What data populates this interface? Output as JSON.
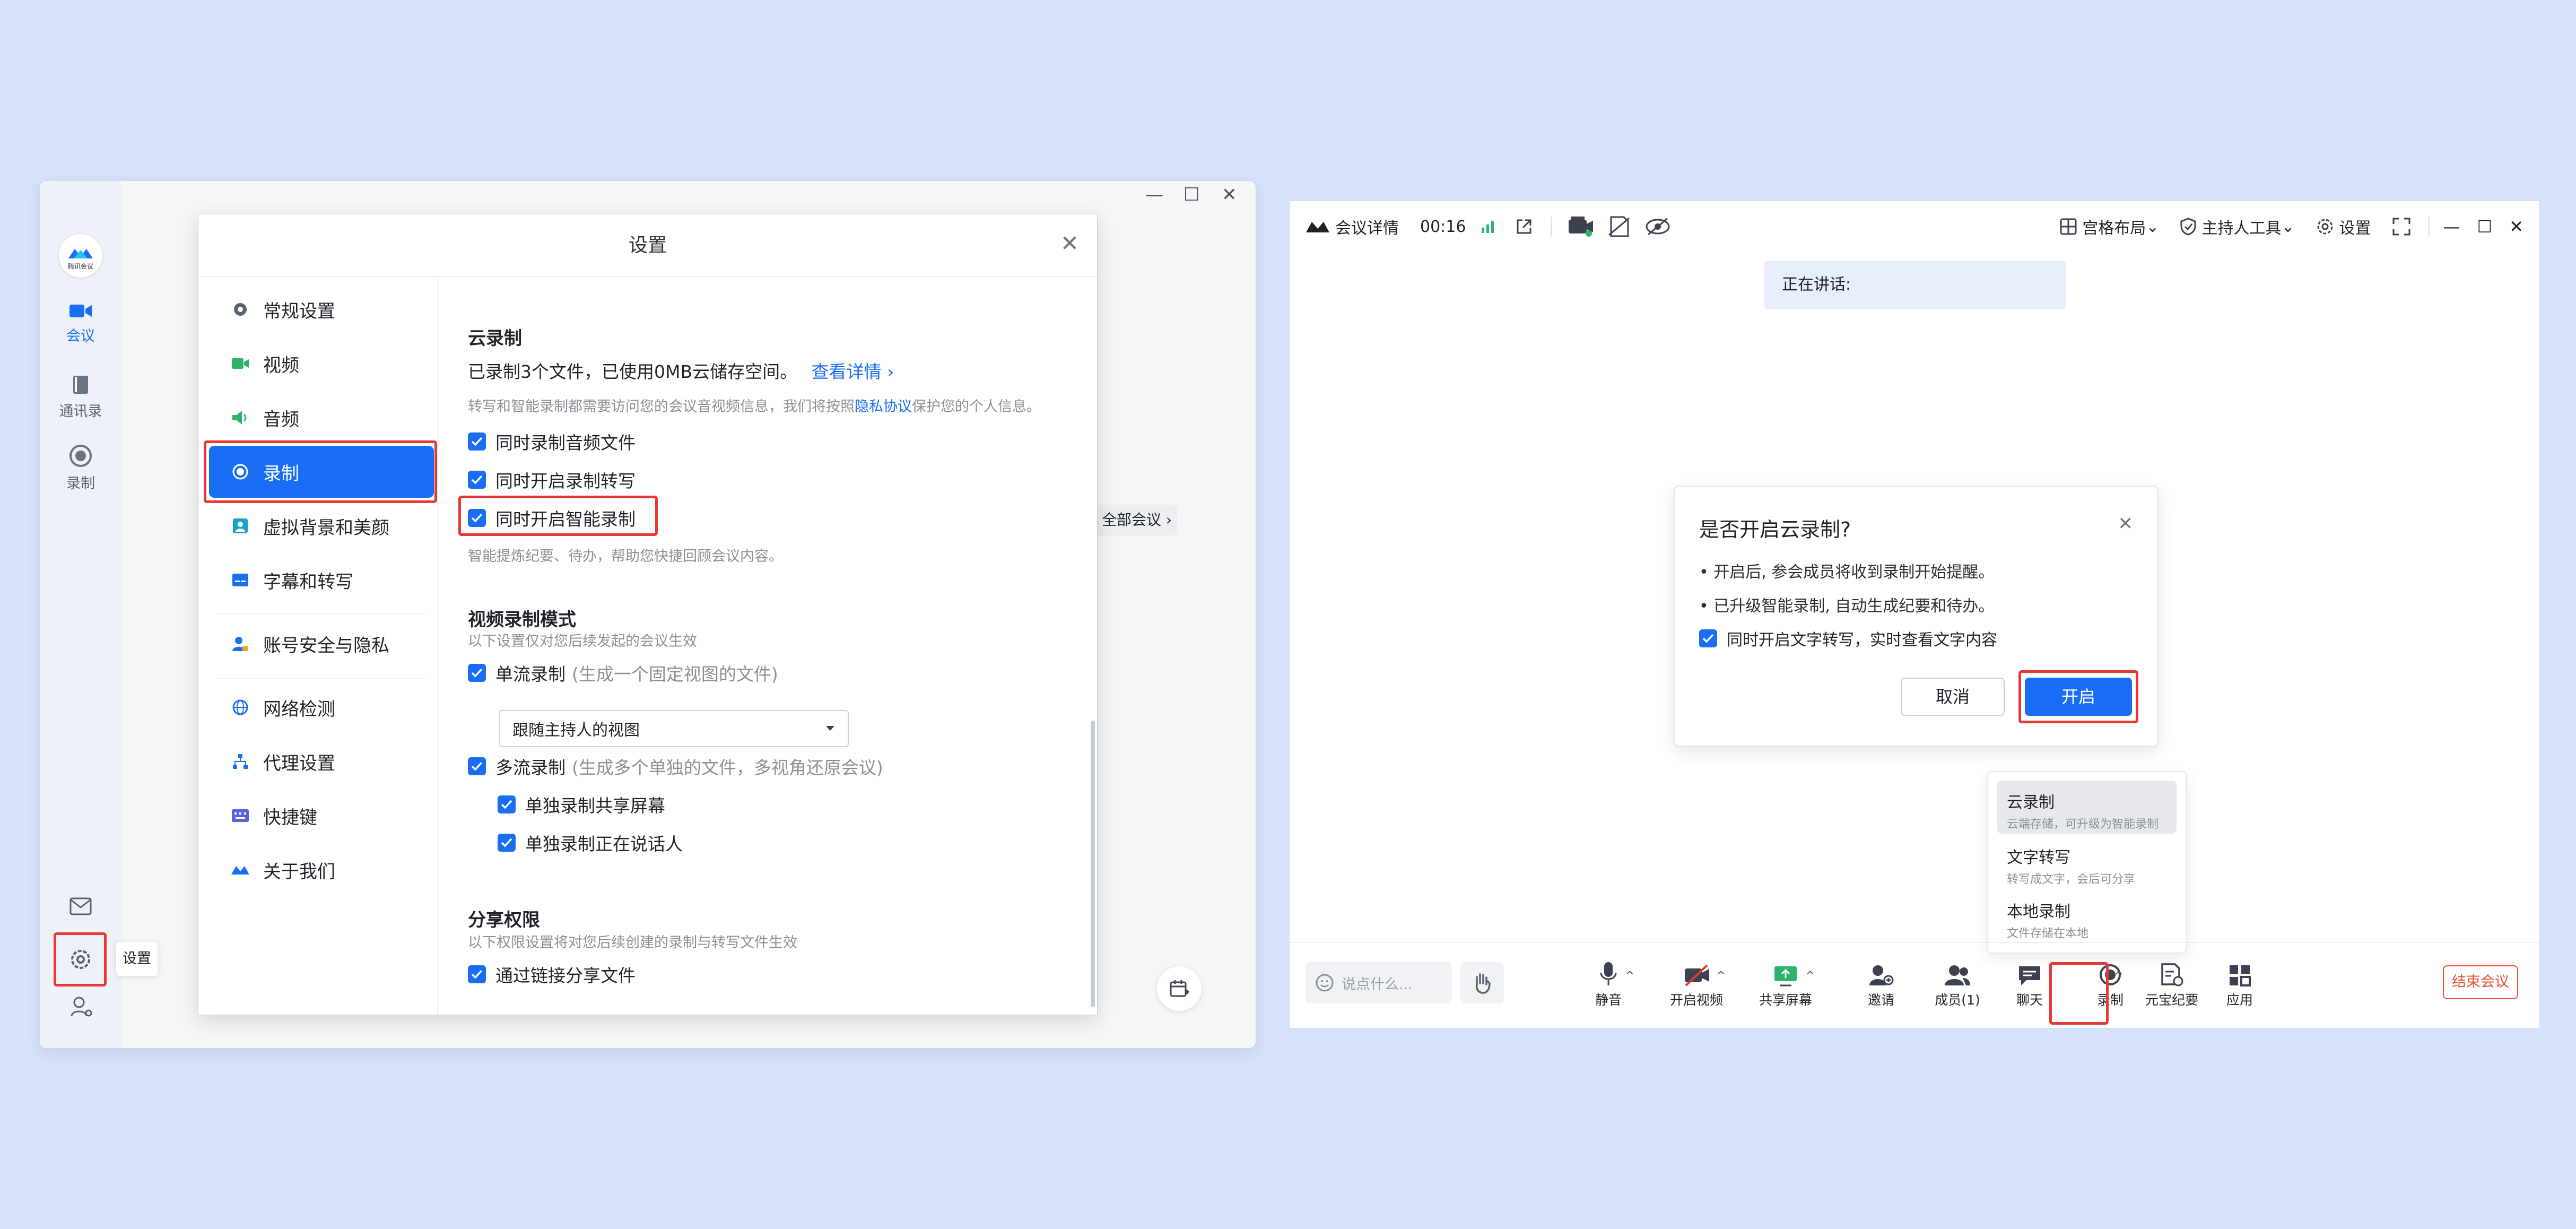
{
  "colors": {
    "accent": "#1a6ef5",
    "highlight": "#e53935",
    "background": "#d6e2fb",
    "end_meeting": "#e8503a"
  },
  "left_window": {
    "logo_caption": "腾讯会议",
    "rail": [
      {
        "label": "会议",
        "icon": "video-camera-icon",
        "active": true
      },
      {
        "label": "通讯录",
        "icon": "address-book-icon",
        "active": false
      },
      {
        "label": "录制",
        "icon": "record-icon",
        "active": false
      }
    ],
    "rail_bottom": {
      "mail_icon": "mail-icon",
      "settings_icon": "gear-icon",
      "settings_tooltip": "设置",
      "user_icon": "user-gear-icon"
    },
    "behind_link": "全部会议",
    "settings": {
      "title": "设置",
      "nav": [
        {
          "label": "常规设置",
          "icon": "gear-icon"
        },
        {
          "label": "视频",
          "icon": "video-icon"
        },
        {
          "label": "音频",
          "icon": "speaker-icon"
        },
        {
          "label": "录制",
          "icon": "record-icon"
        },
        {
          "label": "虚拟背景和美颜",
          "icon": "portrait-icon"
        },
        {
          "label": "字幕和转写",
          "icon": "subtitle-icon"
        },
        {
          "label": "账号安全与隐私",
          "icon": "account-lock-icon"
        },
        {
          "label": "网络检测",
          "icon": "globe-icon"
        },
        {
          "label": "代理设置",
          "icon": "network-icon"
        },
        {
          "label": "快捷键",
          "icon": "keyboard-icon"
        },
        {
          "label": "关于我们",
          "icon": "logo-icon"
        }
      ],
      "cloud": {
        "title": "云录制",
        "usage": "已录制3个文件，已使用0MB云储存空间。",
        "usage_link": "查看详情",
        "privacy_prefix": "转写和智能录制都需要访问您的会议音视频信息，我们将按照",
        "privacy_link": "隐私协议",
        "privacy_suffix": "保护您的个人信息。",
        "options": [
          "同时录制音频文件",
          "同时开启录制转写",
          "同时开启智能录制"
        ],
        "smart_hint": "智能提炼纪要、待办，帮助您快捷回顾会议内容。"
      },
      "video_mode": {
        "title": "视频录制模式",
        "hint": "以下设置仅对您后续发起的会议生效",
        "single": "单流录制",
        "single_note": "(生成一个固定视图的文件)",
        "select_value": "跟随主持人的视图",
        "multi": "多流录制",
        "multi_note": "(生成多个单独的文件，多视角还原会议)",
        "sub_options": [
          "单独录制共享屏幕",
          "单独录制正在说话人"
        ]
      },
      "share": {
        "title": "分享权限",
        "hint": "以下权限设置将对您后续创建的录制与转写文件生效",
        "option": "通过链接分享文件"
      }
    }
  },
  "right_window": {
    "topbar": {
      "details": "会议详情",
      "time": "00:16",
      "layout": "宫格布局",
      "host_tools": "主持人工具",
      "settings": "设置"
    },
    "speaking": "正在讲话:",
    "dialog": {
      "title": "是否开启云录制?",
      "line1": "• 开启后, 参会成员将收到录制开始提醒。",
      "line2": "• 已升级智能录制, 自动生成纪要和待办。",
      "checkbox": "同时开启文字转写，实时查看文字内容",
      "cancel": "取消",
      "confirm": "开启"
    },
    "record_menu": [
      {
        "title": "云录制",
        "sub": "云端存储，可升级为智能录制"
      },
      {
        "title": "文字转写",
        "sub": "转写成文字，会后可分享"
      },
      {
        "title": "本地录制",
        "sub": "文件存储在本地"
      }
    ],
    "chat_placeholder": "说点什么...",
    "toolbar": [
      {
        "label": "静音",
        "icon": "microphone-icon"
      },
      {
        "label": "开启视频",
        "icon": "video-off-icon"
      },
      {
        "label": "共享屏幕",
        "icon": "share-screen-icon"
      },
      {
        "label": "邀请",
        "icon": "invite-icon"
      },
      {
        "label": "成员(1)",
        "icon": "members-icon"
      },
      {
        "label": "聊天",
        "icon": "chat-icon"
      },
      {
        "label": "录制",
        "icon": "record-icon"
      },
      {
        "label": "元宝纪要",
        "icon": "notes-icon"
      },
      {
        "label": "应用",
        "icon": "apps-icon"
      }
    ],
    "end_meeting": "结束会议"
  }
}
